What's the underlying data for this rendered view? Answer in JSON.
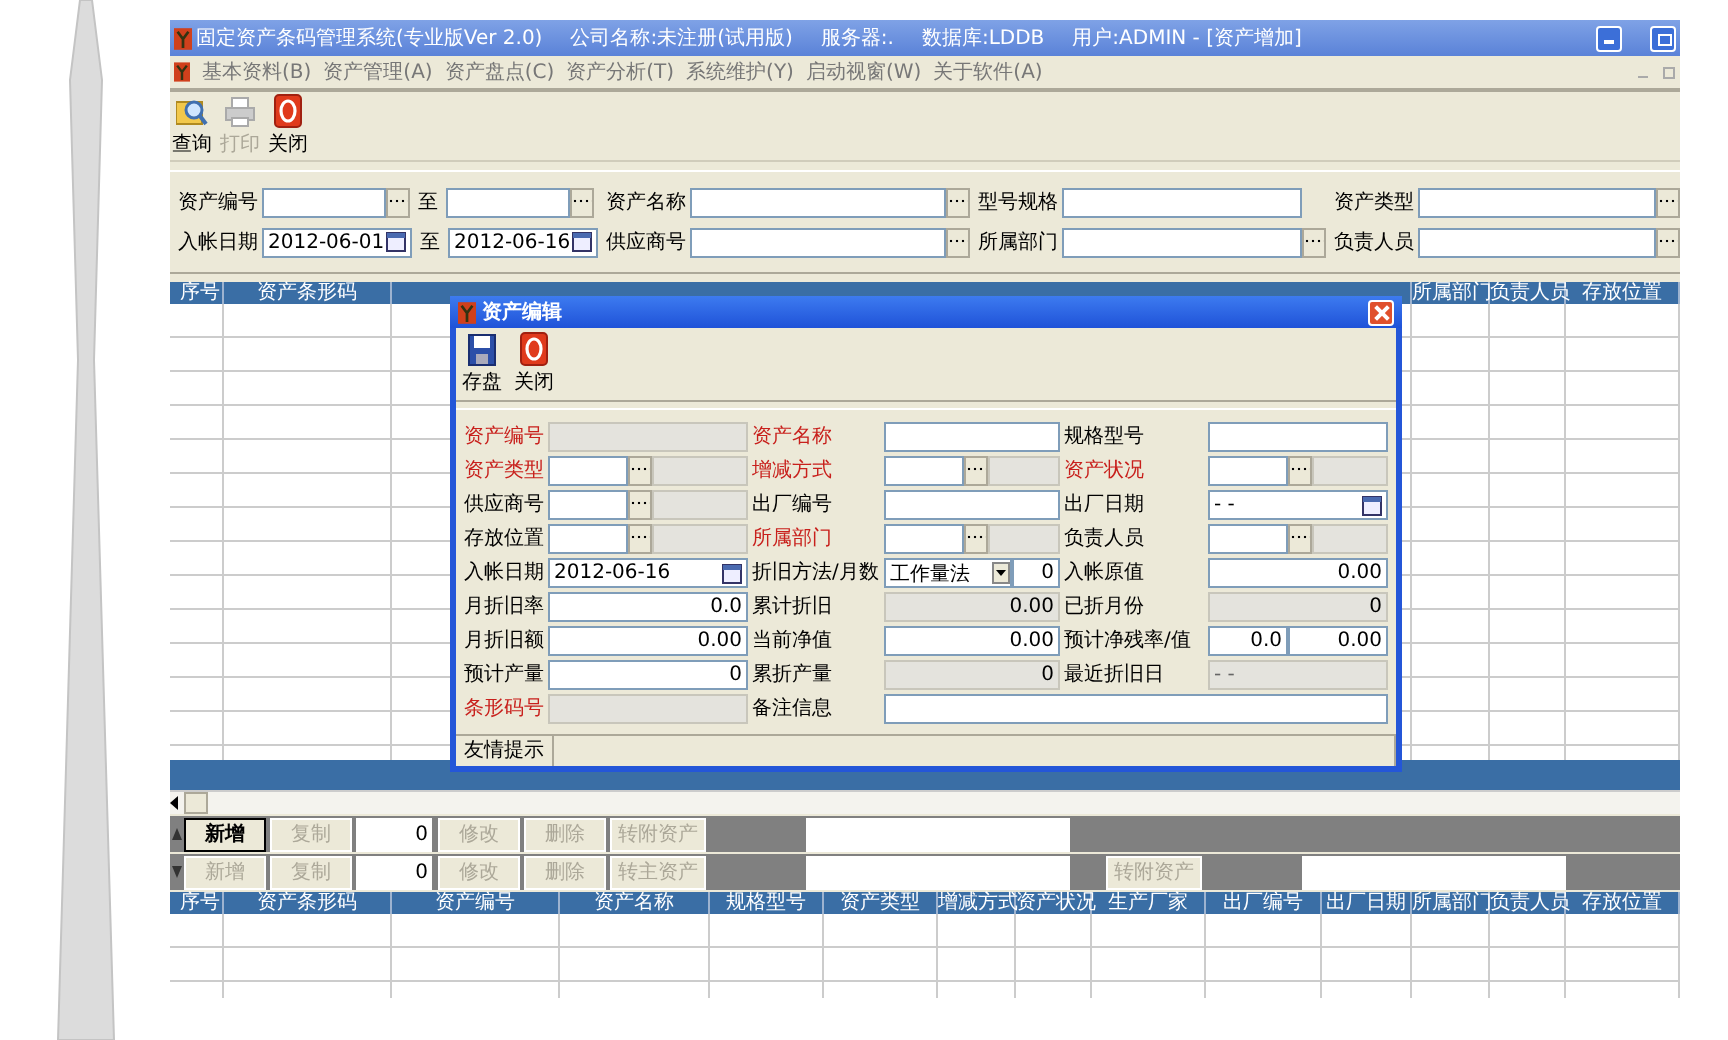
{
  "window": {
    "title_parts": [
      "固定资产条码管理系统(专业版Ver 2.0)",
      "公司名称:未注册(试用版)",
      "服务器:.",
      "数据库:LDDB",
      "用户:ADMIN - [资产增加]"
    ]
  },
  "menu": [
    {
      "label": "基本资料(B)"
    },
    {
      "label": "资产管理(A)"
    },
    {
      "label": "资产盘点(C)"
    },
    {
      "label": "资产分析(T)"
    },
    {
      "label": "系统维护(Y)"
    },
    {
      "label": "启动视窗(W)"
    },
    {
      "label": "关于软件(A)"
    }
  ],
  "toolbar": [
    {
      "kind": "search",
      "label": "查询",
      "disabled": false
    },
    {
      "kind": "print",
      "label": "打印",
      "disabled": true
    },
    {
      "kind": "exit",
      "label": "关闭",
      "disabled": false
    }
  ],
  "filters": [
    {
      "kind": "range",
      "label": "资产编号",
      "separator": "至"
    },
    {
      "kind": "lookup",
      "label": "资产名称"
    },
    {
      "kind": "text",
      "label": "型号规格"
    },
    {
      "kind": "lookup",
      "label": "资产类型"
    },
    {
      "kind": "date_range",
      "label": "入帐日期",
      "from": "2012-06-01",
      "separator": "至",
      "to": "2012-06-16"
    },
    {
      "kind": "lookup",
      "label": "供应商号"
    },
    {
      "kind": "lookup",
      "label": "所属部门"
    },
    {
      "kind": "lookup",
      "label": "负责人员"
    }
  ],
  "upper_table": {
    "columns": [
      "序号",
      "资产条形码",
      "所属部门",
      "负责人员",
      "存放位置"
    ]
  },
  "dialog": {
    "title": "资产编辑",
    "toolbar": [
      {
        "kind": "save",
        "label": "存盘"
      },
      {
        "kind": "exit",
        "label": "关闭"
      }
    ],
    "fields": [
      {
        "label": "资产编号",
        "required": true,
        "kind": "readonly"
      },
      {
        "label": "资产名称",
        "required": true,
        "kind": "text"
      },
      {
        "label": "规格型号",
        "required": false,
        "kind": "text"
      },
      {
        "label": "资产类型",
        "required": true,
        "kind": "lookup"
      },
      {
        "label": "增减方式",
        "required": true,
        "kind": "lookup"
      },
      {
        "label": "资产状况",
        "required": true,
        "kind": "lookup"
      },
      {
        "label": "供应商号",
        "required": false,
        "kind": "lookup"
      },
      {
        "label": "出厂编号",
        "required": false,
        "kind": "text"
      },
      {
        "label": "出厂日期",
        "required": false,
        "kind": "date",
        "value": "- -"
      },
      {
        "label": "存放位置",
        "required": false,
        "kind": "lookup"
      },
      {
        "label": "所属部门",
        "required": true,
        "kind": "lookup"
      },
      {
        "label": "负责人员",
        "required": false,
        "kind": "lookup"
      },
      {
        "label": "入帐日期",
        "required": false,
        "kind": "date",
        "value": "2012-06-16"
      },
      {
        "label": "折旧方法/月数",
        "required": false,
        "kind": "select",
        "value": "工作量法",
        "number": "0"
      },
      {
        "label": "入帐原值",
        "required": false,
        "kind": "number",
        "value": "0.00"
      },
      {
        "label": "月折旧率",
        "required": false,
        "kind": "number",
        "value": "0.0"
      },
      {
        "label": "累计折旧",
        "required": false,
        "kind": "readonly",
        "value": "0.00"
      },
      {
        "label": "已折月份",
        "required": false,
        "kind": "readonly",
        "value": "0"
      },
      {
        "label": "月折旧额",
        "required": false,
        "kind": "number",
        "value": "0.00"
      },
      {
        "label": "当前净值",
        "required": false,
        "kind": "number",
        "value": "0.00"
      },
      {
        "label": "预计净残率/值",
        "required": false,
        "kind": "pair",
        "value": "0.0",
        "number": "0.00"
      },
      {
        "label": "预计产量",
        "required": false,
        "kind": "number",
        "value": "0"
      },
      {
        "label": "累折产量",
        "required": false,
        "kind": "readonly",
        "value": "0"
      },
      {
        "label": "最近折旧日",
        "required": false,
        "kind": "readonly_date",
        "value": "- -"
      },
      {
        "label": "条形码号",
        "required": true,
        "kind": "readonly"
      },
      {
        "label": "备注信息",
        "required": false,
        "kind": "memo"
      }
    ],
    "status": "友情提示"
  },
  "button_bars": [
    {
      "items": [
        {
          "kind": "button",
          "label": "新增",
          "disabled": false
        },
        {
          "kind": "button",
          "label": "复制",
          "disabled": true
        },
        {
          "kind": "count",
          "value": "0"
        },
        {
          "kind": "button",
          "label": "修改",
          "disabled": true
        },
        {
          "kind": "button",
          "label": "删除",
          "disabled": true
        },
        {
          "kind": "button",
          "label": "转附资产",
          "disabled": true
        },
        {
          "kind": "field"
        }
      ]
    },
    {
      "items": [
        {
          "kind": "button",
          "label": "新增",
          "disabled": true
        },
        {
          "kind": "button",
          "label": "复制",
          "disabled": true
        },
        {
          "kind": "count",
          "value": "0"
        },
        {
          "kind": "button",
          "label": "修改",
          "disabled": true
        },
        {
          "kind": "button",
          "label": "删除",
          "disabled": true
        },
        {
          "kind": "button",
          "label": "转主资产",
          "disabled": true
        },
        {
          "kind": "field"
        },
        {
          "kind": "button",
          "label": "转附资产",
          "disabled": true
        },
        {
          "kind": "field"
        }
      ]
    }
  ],
  "lower_table": {
    "columns": [
      "序号",
      "资产条形码",
      "资产编号",
      "资产名称",
      "规格型号",
      "资产类型",
      "增减方式",
      "资产状况",
      "生产厂家",
      "出厂编号",
      "出厂日期",
      "所属部门",
      "负责人员",
      "存放位置"
    ]
  }
}
